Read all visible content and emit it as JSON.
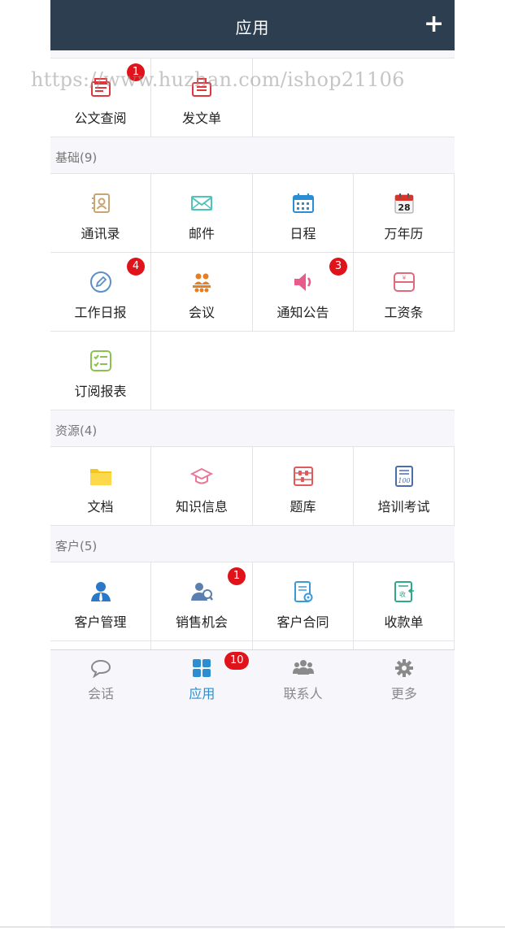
{
  "header": {
    "title": "应用",
    "add_label": "+"
  },
  "watermark": "https://www.huzhan.com/ishop21106",
  "sections": [
    {
      "label": "",
      "items": [
        {
          "label": "公文查阅",
          "icon": "document-review-icon",
          "badge": "1"
        },
        {
          "label": "发文单",
          "icon": "dispatch-doc-icon",
          "badge": ""
        }
      ]
    },
    {
      "label": "基础(9)",
      "items": [
        {
          "label": "通讯录",
          "icon": "contacts-book-icon",
          "badge": ""
        },
        {
          "label": "邮件",
          "icon": "mail-icon",
          "badge": ""
        },
        {
          "label": "日程",
          "icon": "calendar-icon",
          "badge": ""
        },
        {
          "label": "万年历",
          "icon": "perpetual-calendar-icon",
          "badge": "",
          "calendar_day": "28"
        },
        {
          "label": "工作日报",
          "icon": "pencil-circle-icon",
          "badge": "4"
        },
        {
          "label": "会议",
          "icon": "meeting-people-icon",
          "badge": ""
        },
        {
          "label": "通知公告",
          "icon": "speaker-icon",
          "badge": "3"
        },
        {
          "label": "工资条",
          "icon": "payslip-icon",
          "badge": "",
          "currency_symbol": "¥"
        },
        {
          "label": "订阅报表",
          "icon": "checklist-icon",
          "badge": ""
        }
      ]
    },
    {
      "label": "资源(4)",
      "items": [
        {
          "label": "文档",
          "icon": "folder-icon",
          "badge": ""
        },
        {
          "label": "知识信息",
          "icon": "graduation-cap-icon",
          "badge": ""
        },
        {
          "label": "题库",
          "icon": "abacus-icon",
          "badge": ""
        },
        {
          "label": "培训考试",
          "icon": "exam-paper-icon",
          "badge": "",
          "score": "100"
        }
      ]
    },
    {
      "label": "客户(5)",
      "items": [
        {
          "label": "客户管理",
          "icon": "customer-person-icon",
          "badge": ""
        },
        {
          "label": "销售机会",
          "icon": "sales-opportunity-icon",
          "badge": "1"
        },
        {
          "label": "客户合同",
          "icon": "contract-icon",
          "badge": ""
        },
        {
          "label": "收款单",
          "icon": "receipt-icon",
          "badge": "",
          "stamp_text": "收"
        }
      ]
    }
  ],
  "tabbar": {
    "tabs": [
      {
        "label": "会话",
        "icon": "chat-bubble-icon",
        "active": false,
        "badge": ""
      },
      {
        "label": "应用",
        "icon": "apps-grid-icon",
        "active": true,
        "badge": "10"
      },
      {
        "label": "联系人",
        "icon": "people-group-icon",
        "active": false,
        "badge": ""
      },
      {
        "label": "更多",
        "icon": "gear-icon",
        "active": false,
        "badge": ""
      }
    ]
  },
  "colors": {
    "header_bg": "#2c3e50",
    "badge": "#e0131a",
    "active_tab": "#2a8fd2",
    "inactive_tab": "#8a8a8a",
    "page_bg": "#f7f6fb"
  }
}
